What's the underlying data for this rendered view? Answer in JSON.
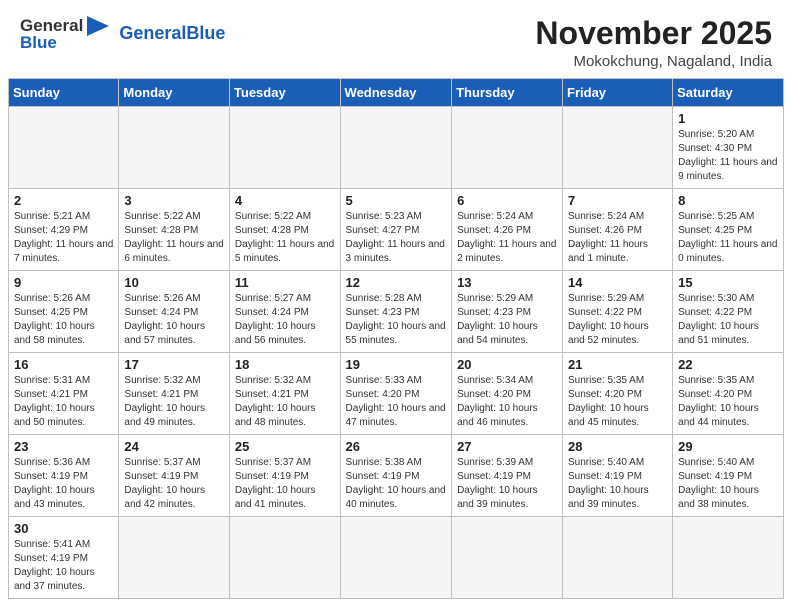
{
  "header": {
    "logo_general": "General",
    "logo_blue": "Blue",
    "month_title": "November 2025",
    "location": "Mokokchung, Nagaland, India"
  },
  "days_of_week": [
    "Sunday",
    "Monday",
    "Tuesday",
    "Wednesday",
    "Thursday",
    "Friday",
    "Saturday"
  ],
  "weeks": [
    [
      {
        "day": "",
        "info": "",
        "empty": true
      },
      {
        "day": "",
        "info": "",
        "empty": true
      },
      {
        "day": "",
        "info": "",
        "empty": true
      },
      {
        "day": "",
        "info": "",
        "empty": true
      },
      {
        "day": "",
        "info": "",
        "empty": true
      },
      {
        "day": "",
        "info": "",
        "empty": true
      },
      {
        "day": "1",
        "info": "Sunrise: 5:20 AM\nSunset: 4:30 PM\nDaylight: 11 hours\nand 9 minutes.",
        "empty": false
      }
    ],
    [
      {
        "day": "2",
        "info": "Sunrise: 5:21 AM\nSunset: 4:29 PM\nDaylight: 11 hours\nand 7 minutes.",
        "empty": false
      },
      {
        "day": "3",
        "info": "Sunrise: 5:22 AM\nSunset: 4:28 PM\nDaylight: 11 hours\nand 6 minutes.",
        "empty": false
      },
      {
        "day": "4",
        "info": "Sunrise: 5:22 AM\nSunset: 4:28 PM\nDaylight: 11 hours\nand 5 minutes.",
        "empty": false
      },
      {
        "day": "5",
        "info": "Sunrise: 5:23 AM\nSunset: 4:27 PM\nDaylight: 11 hours\nand 3 minutes.",
        "empty": false
      },
      {
        "day": "6",
        "info": "Sunrise: 5:24 AM\nSunset: 4:26 PM\nDaylight: 11 hours\nand 2 minutes.",
        "empty": false
      },
      {
        "day": "7",
        "info": "Sunrise: 5:24 AM\nSunset: 4:26 PM\nDaylight: 11 hours\nand 1 minute.",
        "empty": false
      },
      {
        "day": "8",
        "info": "Sunrise: 5:25 AM\nSunset: 4:25 PM\nDaylight: 11 hours\nand 0 minutes.",
        "empty": false
      }
    ],
    [
      {
        "day": "9",
        "info": "Sunrise: 5:26 AM\nSunset: 4:25 PM\nDaylight: 10 hours\nand 58 minutes.",
        "empty": false
      },
      {
        "day": "10",
        "info": "Sunrise: 5:26 AM\nSunset: 4:24 PM\nDaylight: 10 hours\nand 57 minutes.",
        "empty": false
      },
      {
        "day": "11",
        "info": "Sunrise: 5:27 AM\nSunset: 4:24 PM\nDaylight: 10 hours\nand 56 minutes.",
        "empty": false
      },
      {
        "day": "12",
        "info": "Sunrise: 5:28 AM\nSunset: 4:23 PM\nDaylight: 10 hours\nand 55 minutes.",
        "empty": false
      },
      {
        "day": "13",
        "info": "Sunrise: 5:29 AM\nSunset: 4:23 PM\nDaylight: 10 hours\nand 54 minutes.",
        "empty": false
      },
      {
        "day": "14",
        "info": "Sunrise: 5:29 AM\nSunset: 4:22 PM\nDaylight: 10 hours\nand 52 minutes.",
        "empty": false
      },
      {
        "day": "15",
        "info": "Sunrise: 5:30 AM\nSunset: 4:22 PM\nDaylight: 10 hours\nand 51 minutes.",
        "empty": false
      }
    ],
    [
      {
        "day": "16",
        "info": "Sunrise: 5:31 AM\nSunset: 4:21 PM\nDaylight: 10 hours\nand 50 minutes.",
        "empty": false
      },
      {
        "day": "17",
        "info": "Sunrise: 5:32 AM\nSunset: 4:21 PM\nDaylight: 10 hours\nand 49 minutes.",
        "empty": false
      },
      {
        "day": "18",
        "info": "Sunrise: 5:32 AM\nSunset: 4:21 PM\nDaylight: 10 hours\nand 48 minutes.",
        "empty": false
      },
      {
        "day": "19",
        "info": "Sunrise: 5:33 AM\nSunset: 4:20 PM\nDaylight: 10 hours\nand 47 minutes.",
        "empty": false
      },
      {
        "day": "20",
        "info": "Sunrise: 5:34 AM\nSunset: 4:20 PM\nDaylight: 10 hours\nand 46 minutes.",
        "empty": false
      },
      {
        "day": "21",
        "info": "Sunrise: 5:35 AM\nSunset: 4:20 PM\nDaylight: 10 hours\nand 45 minutes.",
        "empty": false
      },
      {
        "day": "22",
        "info": "Sunrise: 5:35 AM\nSunset: 4:20 PM\nDaylight: 10 hours\nand 44 minutes.",
        "empty": false
      }
    ],
    [
      {
        "day": "23",
        "info": "Sunrise: 5:36 AM\nSunset: 4:19 PM\nDaylight: 10 hours\nand 43 minutes.",
        "empty": false
      },
      {
        "day": "24",
        "info": "Sunrise: 5:37 AM\nSunset: 4:19 PM\nDaylight: 10 hours\nand 42 minutes.",
        "empty": false
      },
      {
        "day": "25",
        "info": "Sunrise: 5:37 AM\nSunset: 4:19 PM\nDaylight: 10 hours\nand 41 minutes.",
        "empty": false
      },
      {
        "day": "26",
        "info": "Sunrise: 5:38 AM\nSunset: 4:19 PM\nDaylight: 10 hours\nand 40 minutes.",
        "empty": false
      },
      {
        "day": "27",
        "info": "Sunrise: 5:39 AM\nSunset: 4:19 PM\nDaylight: 10 hours\nand 39 minutes.",
        "empty": false
      },
      {
        "day": "28",
        "info": "Sunrise: 5:40 AM\nSunset: 4:19 PM\nDaylight: 10 hours\nand 39 minutes.",
        "empty": false
      },
      {
        "day": "29",
        "info": "Sunrise: 5:40 AM\nSunset: 4:19 PM\nDaylight: 10 hours\nand 38 minutes.",
        "empty": false
      }
    ],
    [
      {
        "day": "30",
        "info": "Sunrise: 5:41 AM\nSunset: 4:19 PM\nDaylight: 10 hours\nand 37 minutes.",
        "empty": false
      },
      {
        "day": "",
        "info": "",
        "empty": true
      },
      {
        "day": "",
        "info": "",
        "empty": true
      },
      {
        "day": "",
        "info": "",
        "empty": true
      },
      {
        "day": "",
        "info": "",
        "empty": true
      },
      {
        "day": "",
        "info": "",
        "empty": true
      },
      {
        "day": "",
        "info": "",
        "empty": true
      }
    ]
  ]
}
